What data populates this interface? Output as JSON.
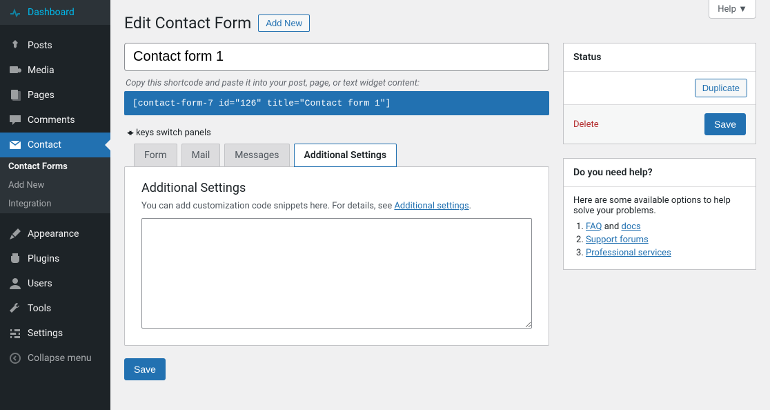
{
  "sidebar": {
    "items": [
      {
        "label": "Dashboard",
        "icon": "dashboard-icon"
      },
      {
        "label": "Posts",
        "icon": "pin-icon"
      },
      {
        "label": "Media",
        "icon": "media-icon"
      },
      {
        "label": "Pages",
        "icon": "page-icon"
      },
      {
        "label": "Comments",
        "icon": "comment-icon"
      },
      {
        "label": "Contact",
        "icon": "mail-icon"
      },
      {
        "label": "Appearance",
        "icon": "brush-icon"
      },
      {
        "label": "Plugins",
        "icon": "plug-icon"
      },
      {
        "label": "Users",
        "icon": "user-icon"
      },
      {
        "label": "Tools",
        "icon": "wrench-icon"
      },
      {
        "label": "Settings",
        "icon": "settings-icon"
      },
      {
        "label": "Collapse menu",
        "icon": "collapse-icon"
      }
    ],
    "submenu": [
      "Contact Forms",
      "Add New",
      "Integration"
    ]
  },
  "help_tab": "Help ▼",
  "header": {
    "title": "Edit Contact Form",
    "add_new": "Add New"
  },
  "form": {
    "title_value": "Contact form 1",
    "shortcode_desc": "Copy this shortcode and paste it into your post, page, or text widget content:",
    "shortcode": "[contact-form-7 id=\"126\" title=\"Contact form 1\"]",
    "keys_hint": "keys switch panels",
    "tabs": [
      "Form",
      "Mail",
      "Messages",
      "Additional Settings"
    ],
    "panel": {
      "heading": "Additional Settings",
      "desc_prefix": "You can add customization code snippets here. For details, see ",
      "desc_link": "Additional settings",
      "desc_suffix": "."
    },
    "save": "Save"
  },
  "status_box": {
    "title": "Status",
    "duplicate": "Duplicate",
    "delete": "Delete",
    "save": "Save"
  },
  "help_box": {
    "title": "Do you need help?",
    "text": "Here are some available options to help solve your problems.",
    "links": {
      "faq": "FAQ",
      "and": " and ",
      "docs": "docs",
      "support": "Support forums",
      "pro": "Professional services"
    }
  }
}
